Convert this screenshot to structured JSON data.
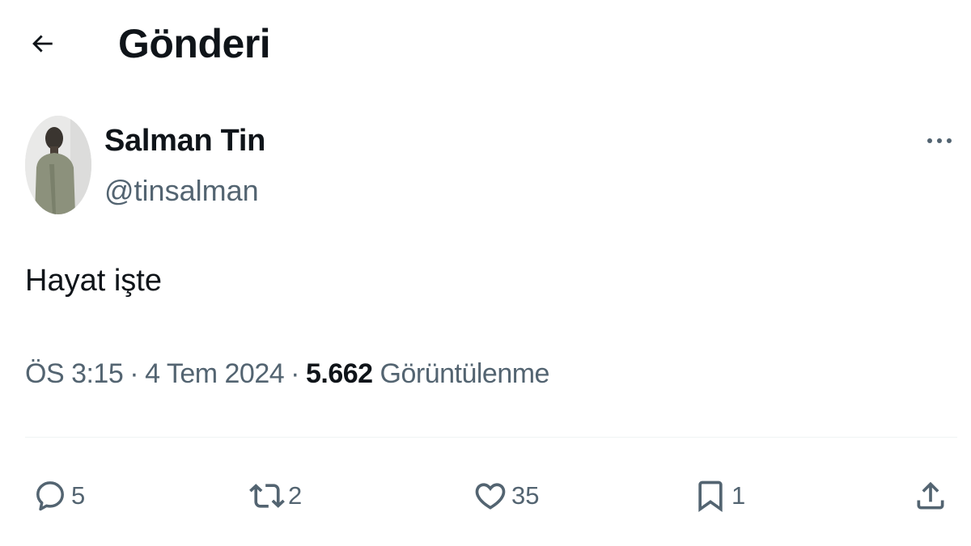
{
  "header": {
    "title": "Gönderi"
  },
  "author": {
    "display_name": "Salman Tin",
    "handle": "@tinsalman"
  },
  "tweet": {
    "text": "Hayat işte"
  },
  "meta": {
    "time": "ÖS 3:15",
    "separator": "·",
    "date": "4 Tem 2024",
    "views_count": "5.662",
    "views_label": "Görüntülenme"
  },
  "actions": {
    "replies": "5",
    "reposts": "2",
    "likes": "35",
    "bookmarks": "1"
  },
  "icons": {
    "back": "arrow-left-icon",
    "more": "more-horizontal-icon",
    "reply": "speech-bubble-icon",
    "repost": "repost-arrows-icon",
    "like": "heart-icon",
    "bookmark": "bookmark-icon",
    "share": "share-upload-icon"
  },
  "colors": {
    "text_primary": "#0f1419",
    "text_secondary": "#536471",
    "divider": "#eff3f4",
    "background": "#ffffff"
  }
}
